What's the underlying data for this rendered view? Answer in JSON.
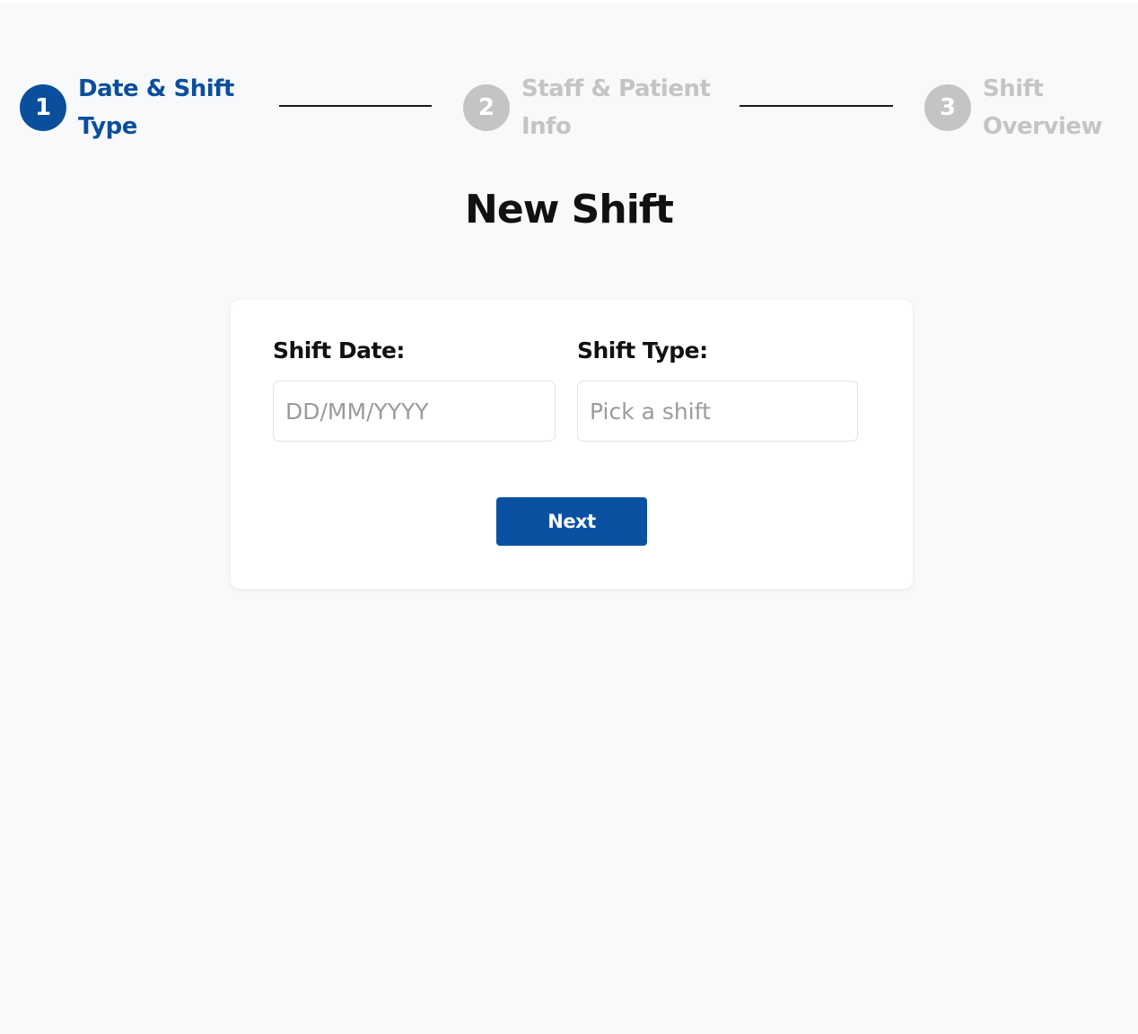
{
  "stepper": {
    "steps": [
      {
        "number": "1",
        "label": "Date & Shift Type",
        "state": "active"
      },
      {
        "number": "2",
        "label": "Staff & Patient Info",
        "state": "inactive"
      },
      {
        "number": "3",
        "label": "Shift Overview",
        "state": "inactive"
      }
    ]
  },
  "page": {
    "title": "New Shift"
  },
  "form": {
    "shift_date": {
      "label": "Shift Date:",
      "placeholder": "DD/MM/YYYY",
      "value": ""
    },
    "shift_type": {
      "label": "Shift Type:",
      "placeholder": "Pick a shift",
      "value": ""
    },
    "next_label": "Next"
  },
  "colors": {
    "primary": "#0a4f9c",
    "inactive": "#c4c4c4",
    "background": "#f8f9fb",
    "card": "#ffffff"
  }
}
